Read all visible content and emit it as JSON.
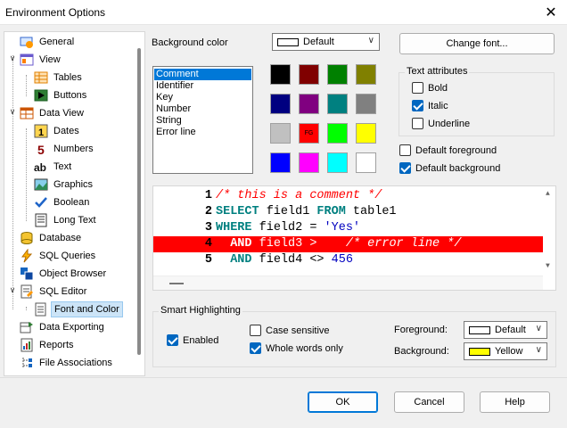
{
  "window": {
    "title": "Environment Options",
    "close": "✕"
  },
  "tree": {
    "items": [
      {
        "label": "General",
        "icon": "general-icon"
      },
      {
        "label": "View",
        "icon": "view-icon"
      },
      {
        "label": "Tables",
        "icon": "tables-icon"
      },
      {
        "label": "Buttons",
        "icon": "buttons-icon"
      },
      {
        "label": "Data View",
        "icon": "data-view-icon"
      },
      {
        "label": "Dates",
        "icon": "dates-icon"
      },
      {
        "label": "Numbers",
        "icon": "numbers-icon"
      },
      {
        "label": "Text",
        "icon": "text-icon"
      },
      {
        "label": "Graphics",
        "icon": "graphics-icon"
      },
      {
        "label": "Boolean",
        "icon": "boolean-icon"
      },
      {
        "label": "Long Text",
        "icon": "long-text-icon"
      },
      {
        "label": "Database",
        "icon": "database-icon"
      },
      {
        "label": "SQL Queries",
        "icon": "sql-queries-icon"
      },
      {
        "label": "Object Browser",
        "icon": "object-browser-icon"
      },
      {
        "label": "SQL Editor",
        "icon": "sql-editor-icon"
      },
      {
        "label": "Font and Color",
        "icon": "font-color-icon"
      },
      {
        "label": "Data Exporting",
        "icon": "data-exporting-icon"
      },
      {
        "label": "Reports",
        "icon": "reports-icon"
      },
      {
        "label": "File Associations",
        "icon": "file-associations-icon"
      }
    ],
    "selected": "Font and Color"
  },
  "background": {
    "label": "Background color",
    "combo_value": "Default",
    "combo_swatch": "#ffffff"
  },
  "change_font_label": "Change font...",
  "elements": {
    "items": [
      "Comment",
      "Identifier",
      "Key",
      "Number",
      "String",
      "Error line"
    ],
    "selected": "Comment"
  },
  "palette": {
    "colors": [
      "#000000",
      "#800000",
      "#008000",
      "#808000",
      "#000080",
      "#800080",
      "#008080",
      "#808080",
      "#c0c0c0",
      "#ff0000",
      "#00ff00",
      "#ffff00",
      "#0000ff",
      "#ff00ff",
      "#00ffff",
      "#ffffff"
    ],
    "fg_marker": "FG",
    "fg_index": 9
  },
  "text_attributes": {
    "title": "Text attributes",
    "bold": {
      "label": "Bold",
      "checked": false
    },
    "italic": {
      "label": "Italic",
      "checked": true
    },
    "underline": {
      "label": "Underline",
      "checked": false
    }
  },
  "default_foreground": {
    "label": "Default foreground",
    "checked": false
  },
  "default_background": {
    "label": "Default background",
    "checked": true
  },
  "preview": {
    "lines": [
      {
        "num": "1",
        "parts": [
          [
            "cmt",
            "/* this is a comment */"
          ]
        ]
      },
      {
        "num": "2",
        "parts": [
          [
            "kw",
            "SELECT"
          ],
          [
            "",
            " field1 "
          ],
          [
            "kw",
            "FROM"
          ],
          [
            "",
            " table1"
          ]
        ]
      },
      {
        "num": "3",
        "parts": [
          [
            "kw",
            "WHERE"
          ],
          [
            "",
            " field2 = "
          ],
          [
            "str",
            "'Yes'"
          ]
        ]
      },
      {
        "num": "4",
        "error": true,
        "parts": [
          [
            "kw",
            "  AND"
          ],
          [
            "",
            " field3 >    "
          ],
          [
            "cmt",
            "/* error line */"
          ]
        ]
      },
      {
        "num": "5",
        "parts": [
          [
            "kw",
            "  AND"
          ],
          [
            "",
            " field4 <> "
          ],
          [
            "str",
            "456"
          ]
        ]
      }
    ]
  },
  "smart_highlighting": {
    "title": "Smart Highlighting",
    "enabled": {
      "label": "Enabled",
      "checked": true
    },
    "case_sensitive": {
      "label": "Case sensitive",
      "checked": false
    },
    "whole_words": {
      "label": "Whole words only",
      "checked": true
    },
    "foreground_label": "Foreground:",
    "foreground_value": "Default",
    "foreground_swatch": "#ffffff",
    "background_label": "Background:",
    "background_value": "Yellow",
    "background_swatch": "#ffff00"
  },
  "buttons": {
    "ok": "OK",
    "cancel": "Cancel",
    "help": "Help"
  }
}
